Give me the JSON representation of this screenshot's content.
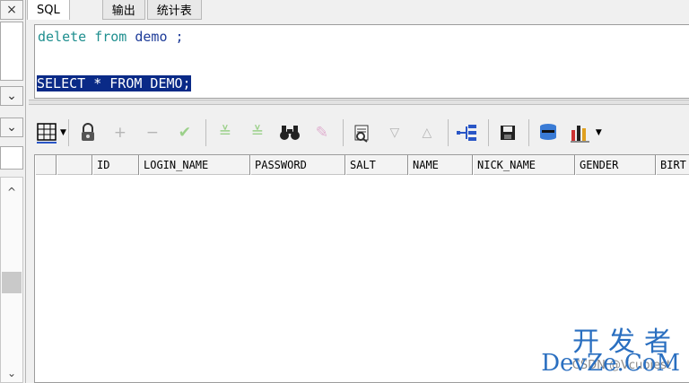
{
  "tabs": [
    {
      "label": "SQL"
    },
    {
      "label": "输出"
    },
    {
      "label": "统计表"
    }
  ],
  "editor": {
    "line1": {
      "kw1": "delete",
      "kw2": "from",
      "ident": "demo",
      "end": ";"
    },
    "line2": {
      "text": "SELECT * FROM DEMO;"
    }
  },
  "left_panel": {
    "close_glyph": "×",
    "down_glyph": "⌄",
    "up_glyph": "^"
  },
  "toolbar": {
    "icons": [
      "grid-icon",
      "lock-icon",
      "plus-icon",
      "minus-icon",
      "check-icon",
      "fetch-next-icon",
      "fetch-all-icon",
      "binoculars-icon",
      "eraser-icon",
      "query-by-example-icon",
      "sort-desc-icon",
      "sort-asc-icon",
      "tree-icon",
      "save-icon",
      "database-icon",
      "chart-icon"
    ]
  },
  "grid": {
    "columns": [
      "",
      "",
      "ID",
      "LOGIN_NAME",
      "PASSWORD",
      "SALT",
      "NAME",
      "NICK_NAME",
      "GENDER",
      "BIRT"
    ]
  },
  "watermark": {
    "chinese": "开发者",
    "english": "DevZe.CoM",
    "csdn": "CSDN @Vcubiest"
  },
  "colors": {
    "keyword": "#1f8f8f",
    "identifier": "#1e3c99",
    "selection": "#0a2a87",
    "watermark": "#2a6fc0"
  }
}
